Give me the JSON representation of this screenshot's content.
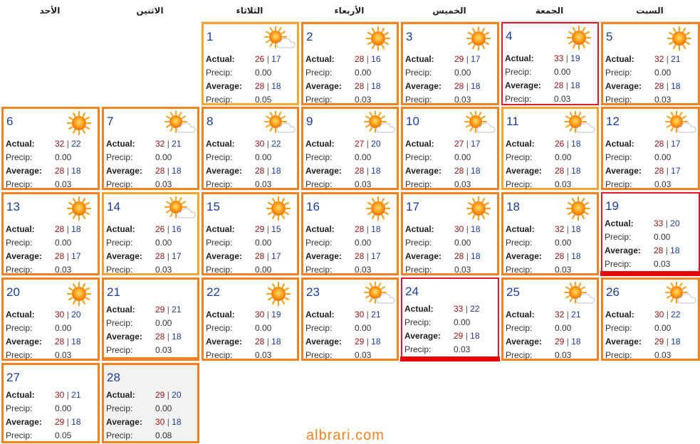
{
  "weekdays": [
    "الأحد",
    "الاثنين",
    "الثلاثاء",
    "الأربعاء",
    "الخميس",
    "الجمعة",
    "السبت"
  ],
  "labels": {
    "actual": "Actual:",
    "precip": "Precip:",
    "average": "Average:"
  },
  "watermark": "albrari.com",
  "colors": {
    "border_orange": "#f5821f",
    "border_light": "#f7a52c",
    "border_red": "#e4182a",
    "bar_red": "#e90000",
    "day_blue": "#1a3e9c",
    "high_red": "#a21515",
    "low_blue": "#1b3a9a"
  },
  "days": [
    {
      "day": "1",
      "icon": "sun-cloud-icon",
      "actual_hi": "26",
      "actual_lo": "17",
      "precip": "0.00",
      "avg_hi": "28",
      "avg_lo": "18",
      "avg_precip": "0.05",
      "style": "light"
    },
    {
      "day": "2",
      "icon": "sun-icon",
      "actual_hi": "28",
      "actual_lo": "16",
      "precip": "0.00",
      "avg_hi": "28",
      "avg_lo": "18",
      "avg_precip": "0.03",
      "style": "orange"
    },
    {
      "day": "3",
      "icon": "sun-icon",
      "actual_hi": "29",
      "actual_lo": "17",
      "precip": "0.00",
      "avg_hi": "28",
      "avg_lo": "18",
      "avg_precip": "0.03",
      "style": "orange"
    },
    {
      "day": "4",
      "icon": "sun-icon",
      "actual_hi": "33",
      "actual_lo": "19",
      "precip": "0.00",
      "avg_hi": "28",
      "avg_lo": "18",
      "avg_precip": "0.03",
      "style": "red"
    },
    {
      "day": "5",
      "icon": "sun-icon",
      "actual_hi": "32",
      "actual_lo": "21",
      "precip": "0.00",
      "avg_hi": "28",
      "avg_lo": "18",
      "avg_precip": "0.03",
      "style": "orange"
    },
    {
      "day": "6",
      "icon": "sun-icon",
      "actual_hi": "32",
      "actual_lo": "22",
      "precip": "0.00",
      "avg_hi": "28",
      "avg_lo": "18",
      "avg_precip": "0.03",
      "style": "orange"
    },
    {
      "day": "7",
      "icon": "sun-cloud-icon",
      "actual_hi": "32",
      "actual_lo": "21",
      "precip": "0.00",
      "avg_hi": "28",
      "avg_lo": "18",
      "avg_precip": "0.03",
      "style": "orange"
    },
    {
      "day": "8",
      "icon": "sun-cloud-icon",
      "actual_hi": "30",
      "actual_lo": "22",
      "precip": "0.00",
      "avg_hi": "28",
      "avg_lo": "18",
      "avg_precip": "0.03",
      "style": "orange"
    },
    {
      "day": "9",
      "icon": "sun-cloud-icon",
      "actual_hi": "27",
      "actual_lo": "20",
      "precip": "0.00",
      "avg_hi": "28",
      "avg_lo": "18",
      "avg_precip": "0.03",
      "style": "orange"
    },
    {
      "day": "10",
      "icon": "sun-cloud-icon",
      "actual_hi": "27",
      "actual_lo": "17",
      "precip": "0.00",
      "avg_hi": "28",
      "avg_lo": "18",
      "avg_precip": "0.03",
      "style": "orange"
    },
    {
      "day": "11",
      "icon": "sun-cloud-icon",
      "actual_hi": "26",
      "actual_lo": "18",
      "precip": "0.00",
      "avg_hi": "28",
      "avg_lo": "18",
      "avg_precip": "0.03",
      "style": "light"
    },
    {
      "day": "12",
      "icon": "sun-cloud-icon",
      "actual_hi": "28",
      "actual_lo": "17",
      "precip": "0.00",
      "avg_hi": "28",
      "avg_lo": "17",
      "avg_precip": "0.03",
      "style": "orange"
    },
    {
      "day": "13",
      "icon": "sun-icon",
      "actual_hi": "28",
      "actual_lo": "18",
      "precip": "0.00",
      "avg_hi": "28",
      "avg_lo": "17",
      "avg_precip": "0.03",
      "style": "orange"
    },
    {
      "day": "14",
      "icon": "sun-cloud-icon",
      "actual_hi": "26",
      "actual_lo": "16",
      "precip": "0.00",
      "avg_hi": "28",
      "avg_lo": "17",
      "avg_precip": "0.03",
      "style": "light"
    },
    {
      "day": "15",
      "icon": "sun-icon",
      "actual_hi": "29",
      "actual_lo": "15",
      "precip": "0.00",
      "avg_hi": "28",
      "avg_lo": "17",
      "avg_precip": "0.00",
      "style": "orange"
    },
    {
      "day": "16",
      "icon": "sun-icon",
      "actual_hi": "28",
      "actual_lo": "18",
      "precip": "0.00",
      "avg_hi": "28",
      "avg_lo": "17",
      "avg_precip": "0.03",
      "style": "orange"
    },
    {
      "day": "17",
      "icon": "sun-icon",
      "actual_hi": "30",
      "actual_lo": "18",
      "precip": "0.00",
      "avg_hi": "28",
      "avg_lo": "18",
      "avg_precip": "0.03",
      "style": "orange"
    },
    {
      "day": "18",
      "icon": "sun-icon",
      "actual_hi": "32",
      "actual_lo": "18",
      "precip": "0.00",
      "avg_hi": "28",
      "avg_lo": "18",
      "avg_precip": "0.03",
      "style": "orange"
    },
    {
      "day": "19",
      "icon": "",
      "actual_hi": "33",
      "actual_lo": "20",
      "precip": "0.00",
      "avg_hi": "28",
      "avg_lo": "18",
      "avg_precip": "0.03",
      "style": "red-bar"
    },
    {
      "day": "20",
      "icon": "sun-icon",
      "actual_hi": "30",
      "actual_lo": "20",
      "precip": "0.00",
      "avg_hi": "28",
      "avg_lo": "18",
      "avg_precip": "0.03",
      "style": "orange"
    },
    {
      "day": "21",
      "icon": "",
      "actual_hi": "29",
      "actual_lo": "21",
      "precip": "0.00",
      "avg_hi": "28",
      "avg_lo": "18",
      "avg_precip": "0.03",
      "style": "orange-bar"
    },
    {
      "day": "22",
      "icon": "sun-icon",
      "actual_hi": "30",
      "actual_lo": "19",
      "precip": "0.00",
      "avg_hi": "28",
      "avg_lo": "18",
      "avg_precip": "0.03",
      "style": "orange"
    },
    {
      "day": "23",
      "icon": "sun-cloud-icon",
      "actual_hi": "30",
      "actual_lo": "21",
      "precip": "0.00",
      "avg_hi": "29",
      "avg_lo": "18",
      "avg_precip": "0.03",
      "style": "orange"
    },
    {
      "day": "24",
      "icon": "",
      "actual_hi": "33",
      "actual_lo": "22",
      "precip": "0.00",
      "avg_hi": "29",
      "avg_lo": "18",
      "avg_precip": "0.03",
      "style": "red-bar"
    },
    {
      "day": "25",
      "icon": "sun-cloud-icon",
      "actual_hi": "32",
      "actual_lo": "21",
      "precip": "0.00",
      "avg_hi": "29",
      "avg_lo": "18",
      "avg_precip": "0.03",
      "style": "orange"
    },
    {
      "day": "26",
      "icon": "sun-cloud-icon",
      "actual_hi": "30",
      "actual_lo": "22",
      "precip": "0.00",
      "avg_hi": "29",
      "avg_lo": "18",
      "avg_precip": "0.03",
      "style": "orange"
    },
    {
      "day": "27",
      "icon": "",
      "actual_hi": "30",
      "actual_lo": "21",
      "precip": "0.00",
      "avg_hi": "29",
      "avg_lo": "18",
      "avg_precip": "0.05",
      "style": "orange"
    },
    {
      "day": "28",
      "icon": "",
      "actual_hi": "29",
      "actual_lo": "20",
      "precip": "0.00",
      "avg_hi": "30",
      "avg_lo": "18",
      "avg_precip": "0.08",
      "style": "gray"
    }
  ]
}
